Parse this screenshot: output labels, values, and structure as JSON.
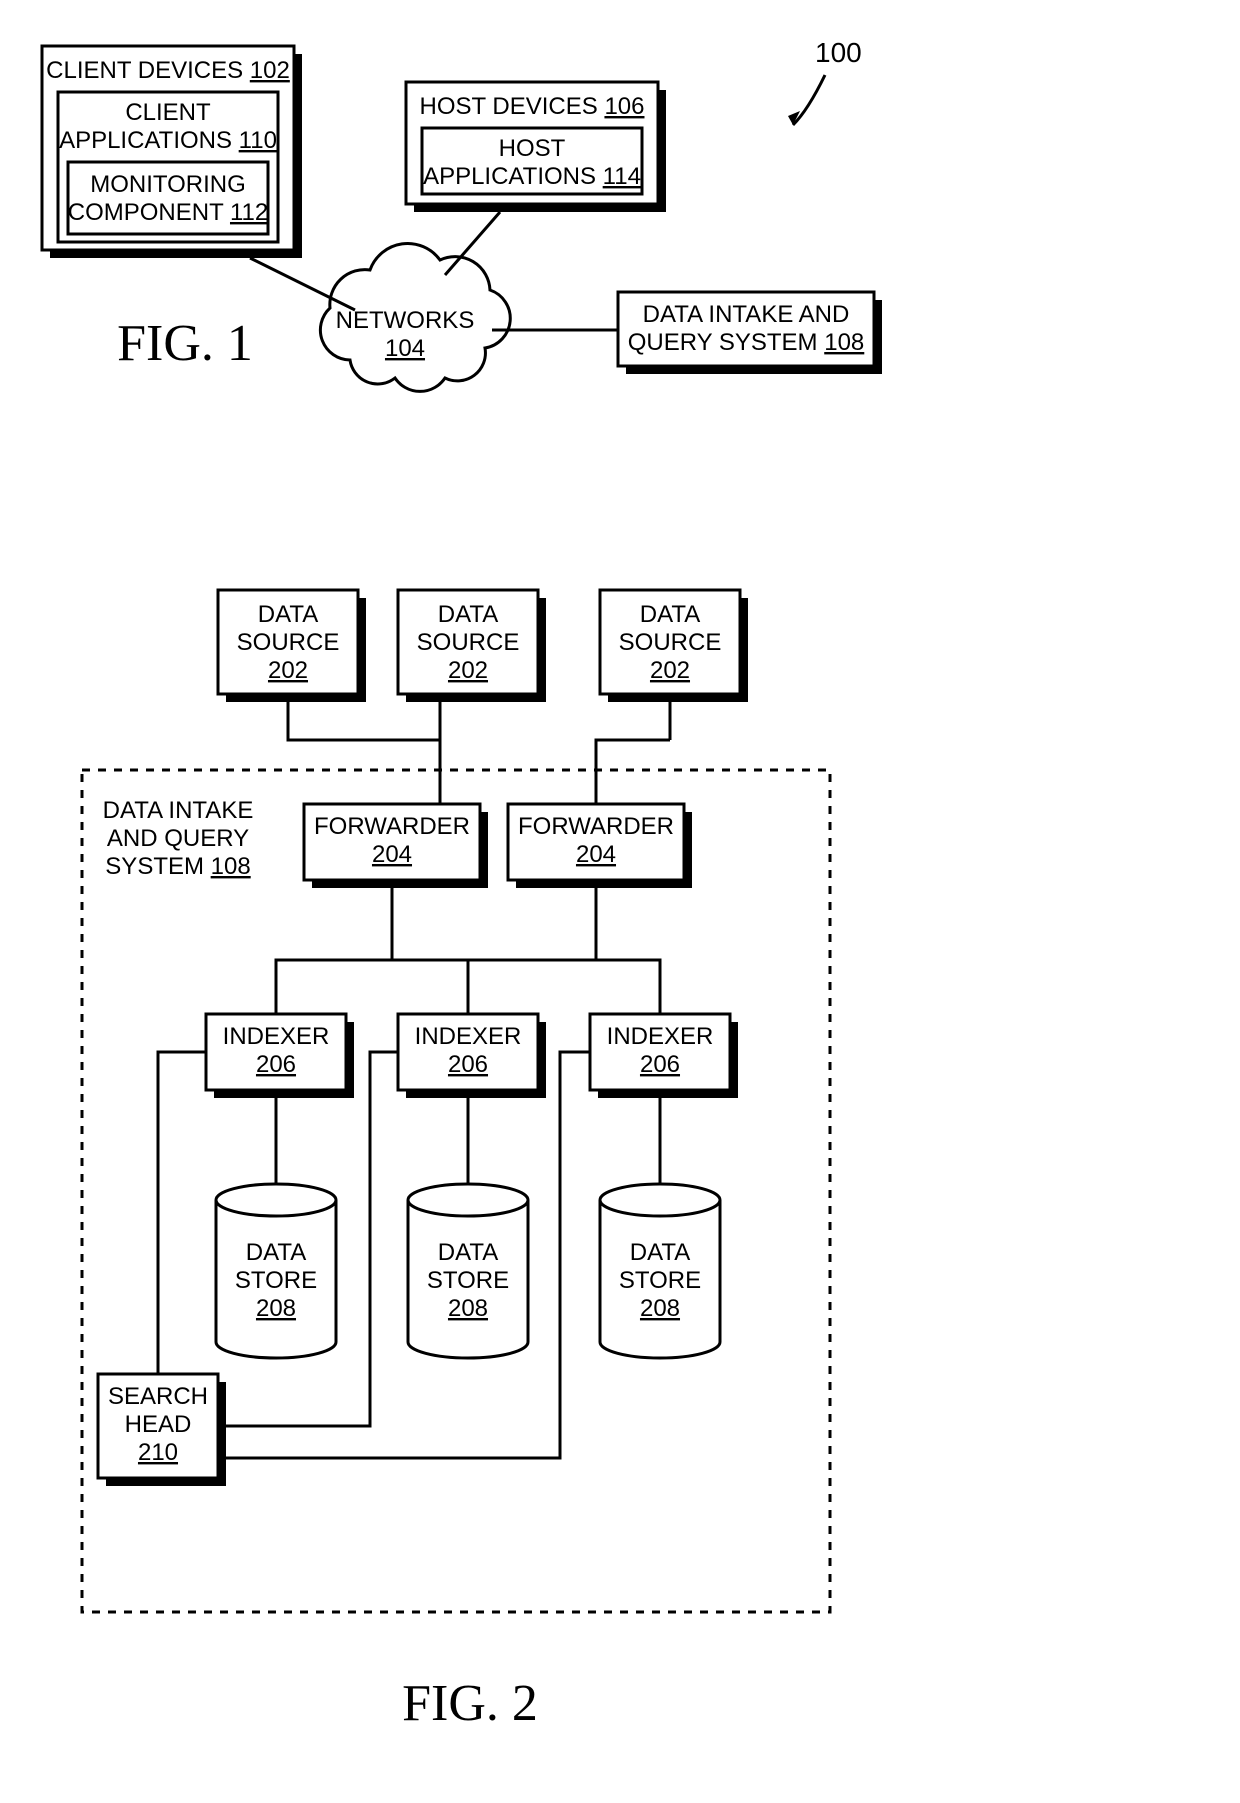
{
  "figure1": {
    "caption": "FIG. 1",
    "ref_overall": "100",
    "client_devices": {
      "label": "CLIENT DEVICES",
      "ref": "102"
    },
    "client_applications": {
      "label": "CLIENT APPLICATIONS",
      "ref": "110"
    },
    "monitoring_component": {
      "label": "MONITORING COMPONENT",
      "ref": "112"
    },
    "host_devices": {
      "label": "HOST DEVICES",
      "ref": "106"
    },
    "host_applications": {
      "label": "HOST APPLICATIONS",
      "ref": "114"
    },
    "networks": {
      "label": "NETWORKS",
      "ref": "104"
    },
    "data_intake_query": {
      "label_line1": "DATA INTAKE AND",
      "label_line2": "QUERY SYSTEM",
      "ref": "108"
    }
  },
  "figure2": {
    "caption": "FIG. 2",
    "data_source": {
      "label_line1": "DATA",
      "label_line2": "SOURCE",
      "ref": "202"
    },
    "system_label": {
      "line1": "DATA INTAKE",
      "line2": "AND QUERY",
      "line3": "SYSTEM",
      "ref": "108"
    },
    "forwarder": {
      "label": "FORWARDER",
      "ref": "204"
    },
    "indexer": {
      "label": "INDEXER",
      "ref": "206"
    },
    "data_store": {
      "label_line1": "DATA",
      "label_line2": "STORE",
      "ref": "208"
    },
    "search_head": {
      "label_line1": "SEARCH",
      "label_line2": "HEAD",
      "ref": "210"
    }
  }
}
